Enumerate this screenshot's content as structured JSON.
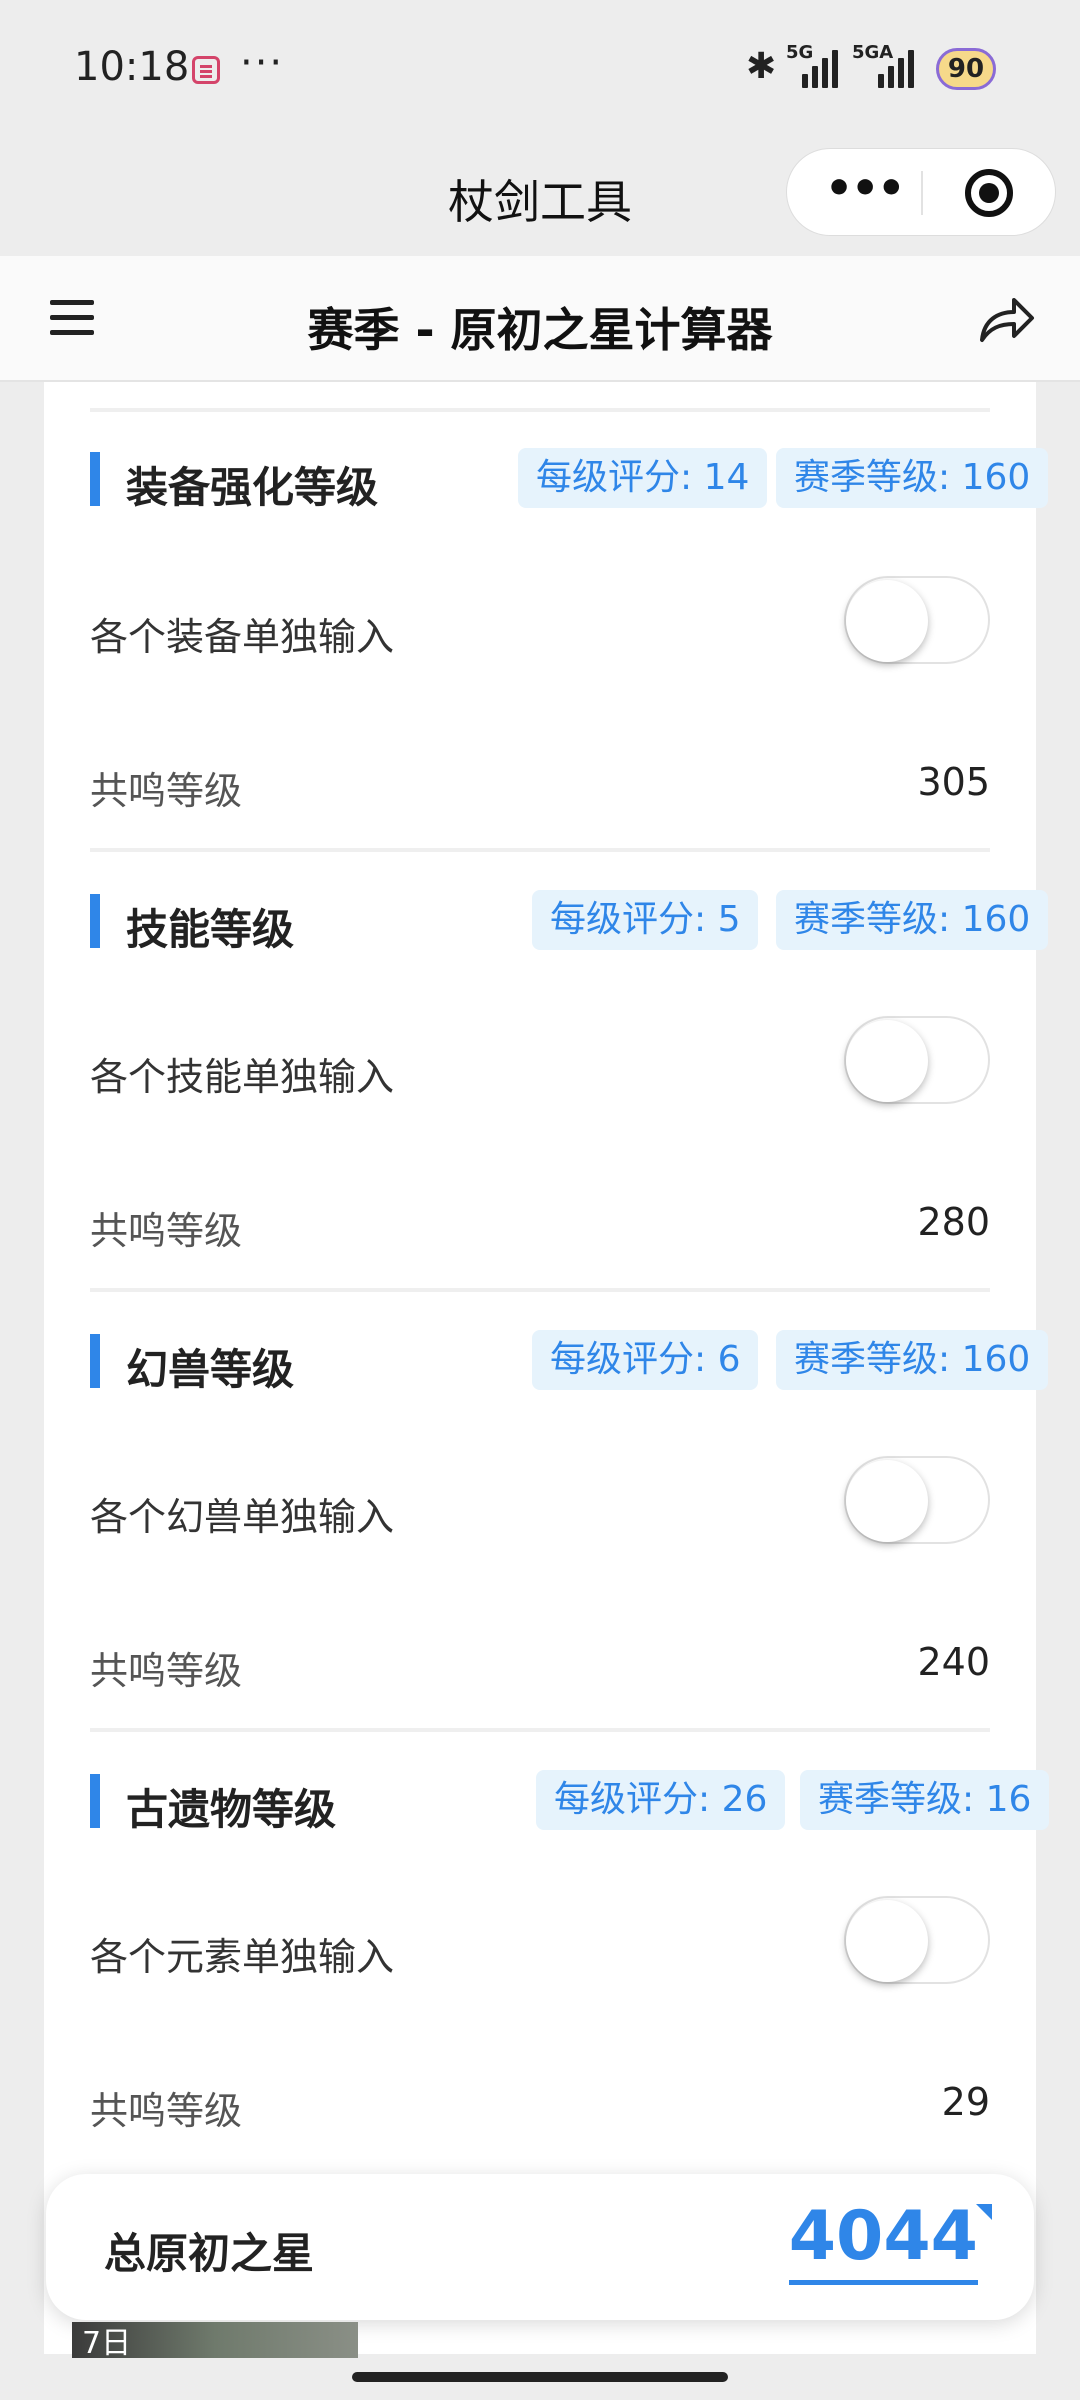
{
  "status_bar": {
    "time": "10:18",
    "more": "···",
    "network1": "5G",
    "network2": "5GA",
    "battery": "90"
  },
  "navbar": {
    "title": "杖剑工具"
  },
  "header": {
    "title": "赛季 - 原初之星计算器"
  },
  "sections": [
    {
      "title": "装备强化等级",
      "tag_score": "每级评分: 14",
      "tag_season": "赛季等级: 160",
      "toggle_label": "各个装备单独输入",
      "toggle_on": false,
      "resonance_label": "共鸣等级",
      "resonance_value": "305"
    },
    {
      "title": "技能等级",
      "tag_score": "每级评分: 5",
      "tag_season": "赛季等级: 160",
      "toggle_label": "各个技能单独输入",
      "toggle_on": false,
      "resonance_label": "共鸣等级",
      "resonance_value": "280"
    },
    {
      "title": "幻兽等级",
      "tag_score": "每级评分: 6",
      "tag_season": "赛季等级: 160",
      "toggle_label": "各个幻兽单独输入",
      "toggle_on": false,
      "resonance_label": "共鸣等级",
      "resonance_value": "240"
    },
    {
      "title": "古遗物等级",
      "tag_score": "每级评分: 26",
      "tag_season": "赛季等级: 16",
      "toggle_label": "各个元素单独输入",
      "toggle_on": false,
      "resonance_label": "共鸣等级",
      "resonance_value": "29"
    }
  ],
  "total": {
    "label": "总原初之星",
    "value": "4044"
  },
  "thumbnail": {
    "label": "7日"
  },
  "colors": {
    "accent": "#2f86e8",
    "tag_bg": "#e6f3fc",
    "page_bg": "#ededed"
  }
}
